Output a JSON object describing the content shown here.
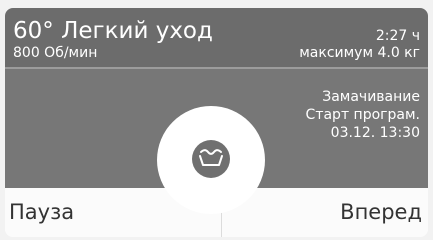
{
  "header": {
    "program_title": "60° Легкий уход",
    "spin_speed": "800 Об/мин",
    "duration": "2:27 ч",
    "max_load": "максимум 4.0 кг"
  },
  "options": {
    "soak": "Замачивание",
    "start_program": "Старт програм.",
    "start_datetime": "03.12.  13:30"
  },
  "buttons": {
    "pause": "Пауза",
    "next": "Вперед"
  },
  "dial": {
    "icon": "wash-tub-icon"
  },
  "colors": {
    "header_bg": "#6c6c6c",
    "options_bg": "#777777",
    "button_bg": "#fbfbfb",
    "text_light": "#ffffff",
    "text_dark": "#333333"
  }
}
